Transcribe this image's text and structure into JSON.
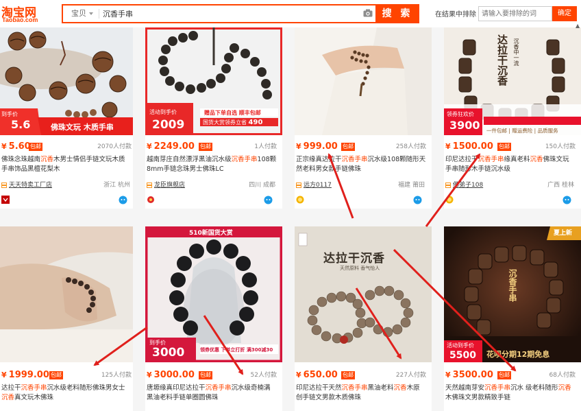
{
  "header": {
    "logo_main": "淘宝网",
    "logo_sub": "Taobao.com",
    "search_type": "宝贝",
    "search_value": "沉香手串",
    "search_button": "搜 索",
    "exclude_label": "在结果中排除",
    "exclude_placeholder": "请输入要排除的词",
    "exclude_button": "确定"
  },
  "colors": {
    "accent": "#ff4400",
    "arrow": "#e0201c"
  },
  "products": [
    {
      "price": "5.60",
      "baoyou": "包邮",
      "sales": "2070人付款",
      "title": [
        "佛珠念珠越南",
        "沉香",
        "木男士情侣手链文玩木质手串饰品黑檀花梨木"
      ],
      "shop": "天天特卖工厂店",
      "location": "浙江 杭州",
      "promo": {
        "tag": "到手价",
        "price": "5.6",
        "text": "佛珠文玩 木质手串"
      }
    },
    {
      "price": "2249.00",
      "baoyou": "包邮",
      "sales": "1人付款",
      "title": [
        "越南芽庄自然漂浮黑油沉水级",
        "沉香手串",
        "108颗8mm手链念珠男士佛珠LC"
      ],
      "shop": "龙臣旗舰店",
      "location": "四川 成都",
      "promo": {
        "tag": "活动到手价",
        "price": "2009",
        "line1": "赠品下单自选",
        "line2": "顺丰包邮",
        "line3": "国货大赏领券立省",
        "line3_price": "490"
      }
    },
    {
      "price": "999.00",
      "baoyou": "包邮",
      "sales": "258人付款",
      "title": [
        "正宗缘真达拉干",
        "沉香手串",
        "沉水级108颗随形天然老料男女款手链佛珠"
      ],
      "shop": "远方0117",
      "location": "福建 莆田",
      "promo": {}
    },
    {
      "price": "1500.00",
      "baoyou": "包邮",
      "sales": "150人付款",
      "title": [
        "印尼达拉干",
        "沉香手串",
        "缘真老料",
        "沉香",
        "佛珠文玩手串随形木手链沉水级"
      ],
      "shop": "佛弟子108",
      "location": "广西 桂林",
      "promo": {
        "headline": "达拉干沉香",
        "sub": "沉香中一流",
        "tag": "领券狂欢价",
        "price": "3900",
        "line": "一件包邮 | 赠运费险 | 品质服务"
      }
    },
    {
      "price": "1999.00",
      "baoyou": "包邮",
      "sales": "125人付款",
      "title": [
        "达拉干",
        "沉香手串",
        "沉水级老料随形佛珠男女士",
        "沉香",
        "真文玩木佛珠"
      ],
      "shop": "",
      "location": "",
      "promo": {}
    },
    {
      "price": "3000.00",
      "baoyou": "包邮",
      "sales": "52人付款",
      "title": [
        "唐塬缘真印尼达拉干",
        "沉香手串",
        "沉水级奇楠满黑油老料手链单圈圆佛珠"
      ],
      "shop": "",
      "location": "",
      "promo": {
        "banner": "510新国货大赏",
        "tag": "到手价",
        "price": "3000",
        "line": "领券优惠 下单立打折 满300减30"
      }
    },
    {
      "price": "650.00",
      "baoyou": "包邮",
      "sales": "227人付款",
      "title": [
        "印尼达拉干天然",
        "沉香手串",
        "黑油老料",
        "沉香",
        "木原创手链文男款木质佛珠"
      ],
      "shop": "",
      "location": "",
      "promo": {
        "headline": "达拉干沉香",
        "sub": "天然原料 香气怡人"
      }
    },
    {
      "price": "3500.00",
      "baoyou": "包邮",
      "sales": "68人付款",
      "title": [
        "天然越南芽安",
        "沉香手串",
        "沉水 级老料随形",
        "沉香",
        "木佛珠文男款精致手链"
      ],
      "shop": "",
      "location": "",
      "promo": {
        "corner": "夏上新",
        "headline": "沉香手串",
        "tag": "活动到手价",
        "price": "5500",
        "line": "花呗分期12期免息"
      }
    }
  ]
}
